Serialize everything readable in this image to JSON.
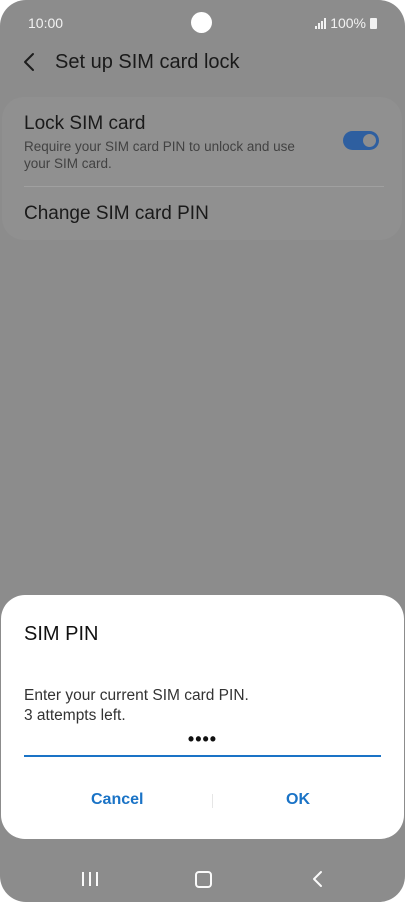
{
  "status_bar": {
    "time": "10:00",
    "battery": "100%"
  },
  "header": {
    "title": "Set up SIM card lock"
  },
  "settings": {
    "lock_sim": {
      "title": "Lock SIM card",
      "subtitle": "Require your SIM card PIN to unlock and use your SIM card.",
      "enabled": true
    },
    "change_pin": {
      "title": "Change SIM card PIN"
    }
  },
  "dialog": {
    "title": "SIM PIN",
    "message_line1": "Enter your current SIM card PIN.",
    "message_line2": "3 attempts left.",
    "pin_value": "••••",
    "cancel_label": "Cancel",
    "ok_label": "OK"
  },
  "colors": {
    "accent": "#1a73c6",
    "toggle_on": "#2e5fa0",
    "scrim": "#8c8c8c"
  },
  "icons": [
    "back-arrow-icon",
    "signal-icon",
    "battery-icon",
    "recents-icon",
    "home-icon",
    "nav-back-icon"
  ]
}
